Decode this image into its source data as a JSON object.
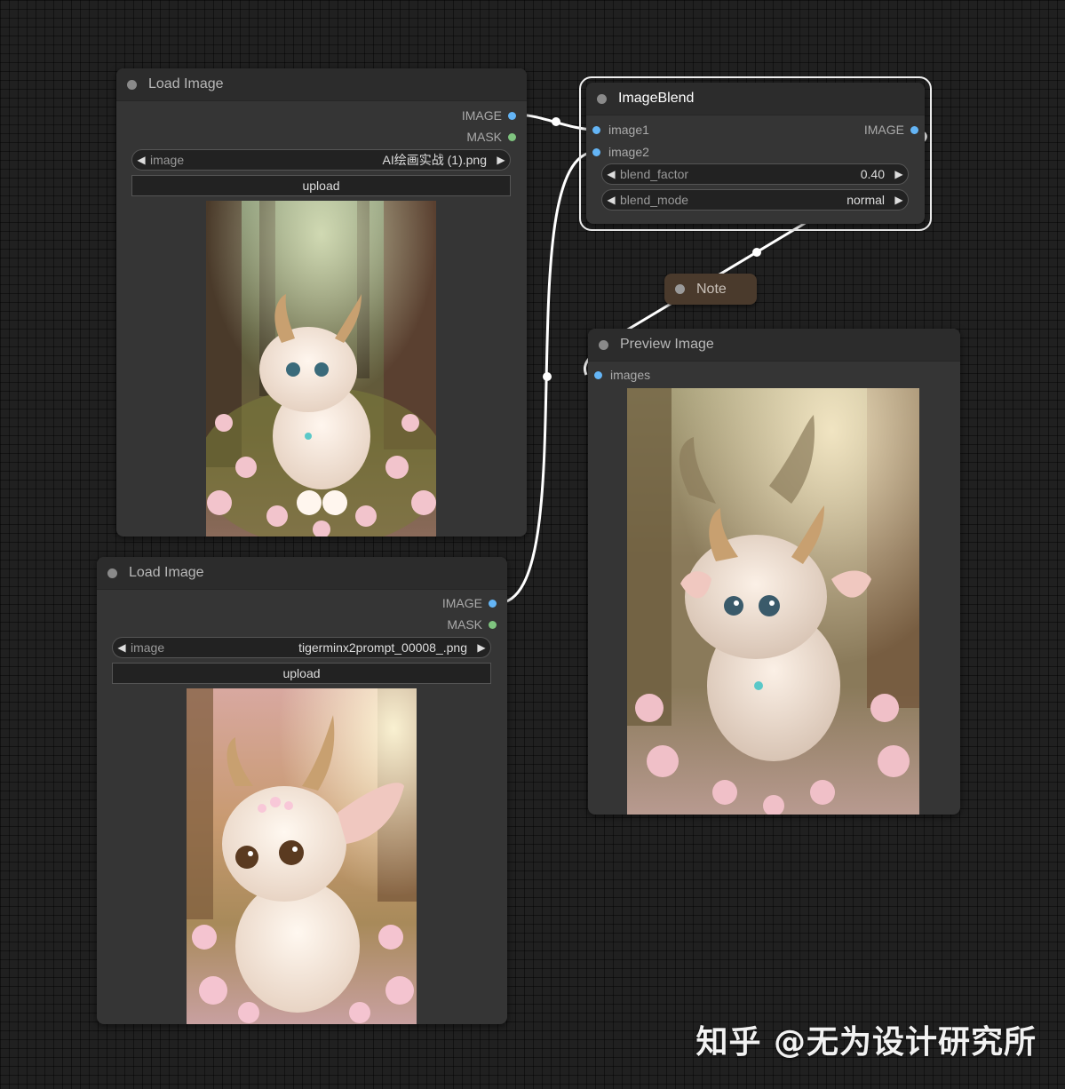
{
  "nodes": {
    "load_image_1": {
      "title": "Load Image",
      "outputs": [
        "IMAGE",
        "MASK"
      ],
      "widget_label": "image",
      "widget_value": "AI绘画实战 (1).png",
      "upload_label": "upload"
    },
    "load_image_2": {
      "title": "Load Image",
      "outputs": [
        "IMAGE",
        "MASK"
      ],
      "widget_label": "image",
      "widget_value": "tigerminx2prompt_00008_.png",
      "upload_label": "upload"
    },
    "image_blend": {
      "title": "ImageBlend",
      "inputs": [
        "image1",
        "image2"
      ],
      "output": "IMAGE",
      "widgets": [
        {
          "label": "blend_factor",
          "value": "0.40"
        },
        {
          "label": "blend_mode",
          "value": "normal"
        }
      ]
    },
    "note": {
      "title": "Note"
    },
    "preview_image": {
      "title": "Preview Image",
      "input": "images"
    }
  },
  "colors": {
    "image_slot": "#64b5f6",
    "mask_slot": "#7fc47f",
    "note_bg": "#4a3a2c",
    "canvas_bg": "#202020"
  },
  "watermark": "知乎 @无为设计研究所"
}
